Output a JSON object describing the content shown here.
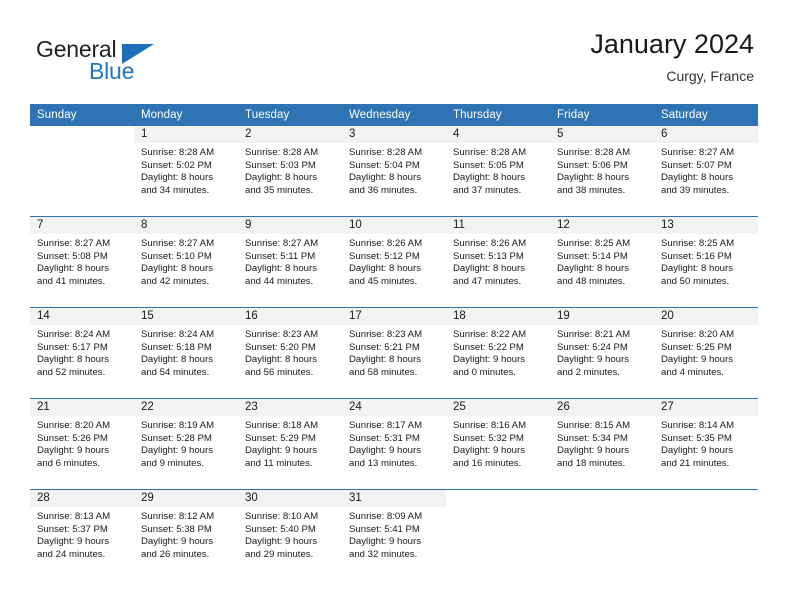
{
  "logo": {
    "word1": "General",
    "word2": "Blue",
    "triangle_color": "#1d70b8",
    "blue_color": "#2176ba"
  },
  "header": {
    "title": "January 2024",
    "location": "Curgy, France",
    "accent_color": "#2e74b5",
    "band_color": "#f2f2f2"
  },
  "weekday_headers": [
    "Sunday",
    "Monday",
    "Tuesday",
    "Wednesday",
    "Thursday",
    "Friday",
    "Saturday"
  ],
  "weeks": [
    [
      {
        "day": "",
        "line1": "",
        "line2": "",
        "line3": "",
        "line4": ""
      },
      {
        "day": "1",
        "line1": "Sunrise: 8:28 AM",
        "line2": "Sunset: 5:02 PM",
        "line3": "Daylight: 8 hours",
        "line4": "and 34 minutes."
      },
      {
        "day": "2",
        "line1": "Sunrise: 8:28 AM",
        "line2": "Sunset: 5:03 PM",
        "line3": "Daylight: 8 hours",
        "line4": "and 35 minutes."
      },
      {
        "day": "3",
        "line1": "Sunrise: 8:28 AM",
        "line2": "Sunset: 5:04 PM",
        "line3": "Daylight: 8 hours",
        "line4": "and 36 minutes."
      },
      {
        "day": "4",
        "line1": "Sunrise: 8:28 AM",
        "line2": "Sunset: 5:05 PM",
        "line3": "Daylight: 8 hours",
        "line4": "and 37 minutes."
      },
      {
        "day": "5",
        "line1": "Sunrise: 8:28 AM",
        "line2": "Sunset: 5:06 PM",
        "line3": "Daylight: 8 hours",
        "line4": "and 38 minutes."
      },
      {
        "day": "6",
        "line1": "Sunrise: 8:27 AM",
        "line2": "Sunset: 5:07 PM",
        "line3": "Daylight: 8 hours",
        "line4": "and 39 minutes."
      }
    ],
    [
      {
        "day": "7",
        "line1": "Sunrise: 8:27 AM",
        "line2": "Sunset: 5:08 PM",
        "line3": "Daylight: 8 hours",
        "line4": "and 41 minutes."
      },
      {
        "day": "8",
        "line1": "Sunrise: 8:27 AM",
        "line2": "Sunset: 5:10 PM",
        "line3": "Daylight: 8 hours",
        "line4": "and 42 minutes."
      },
      {
        "day": "9",
        "line1": "Sunrise: 8:27 AM",
        "line2": "Sunset: 5:11 PM",
        "line3": "Daylight: 8 hours",
        "line4": "and 44 minutes."
      },
      {
        "day": "10",
        "line1": "Sunrise: 8:26 AM",
        "line2": "Sunset: 5:12 PM",
        "line3": "Daylight: 8 hours",
        "line4": "and 45 minutes."
      },
      {
        "day": "11",
        "line1": "Sunrise: 8:26 AM",
        "line2": "Sunset: 5:13 PM",
        "line3": "Daylight: 8 hours",
        "line4": "and 47 minutes."
      },
      {
        "day": "12",
        "line1": "Sunrise: 8:25 AM",
        "line2": "Sunset: 5:14 PM",
        "line3": "Daylight: 8 hours",
        "line4": "and 48 minutes."
      },
      {
        "day": "13",
        "line1": "Sunrise: 8:25 AM",
        "line2": "Sunset: 5:16 PM",
        "line3": "Daylight: 8 hours",
        "line4": "and 50 minutes."
      }
    ],
    [
      {
        "day": "14",
        "line1": "Sunrise: 8:24 AM",
        "line2": "Sunset: 5:17 PM",
        "line3": "Daylight: 8 hours",
        "line4": "and 52 minutes."
      },
      {
        "day": "15",
        "line1": "Sunrise: 8:24 AM",
        "line2": "Sunset: 5:18 PM",
        "line3": "Daylight: 8 hours",
        "line4": "and 54 minutes."
      },
      {
        "day": "16",
        "line1": "Sunrise: 8:23 AM",
        "line2": "Sunset: 5:20 PM",
        "line3": "Daylight: 8 hours",
        "line4": "and 56 minutes."
      },
      {
        "day": "17",
        "line1": "Sunrise: 8:23 AM",
        "line2": "Sunset: 5:21 PM",
        "line3": "Daylight: 8 hours",
        "line4": "and 58 minutes."
      },
      {
        "day": "18",
        "line1": "Sunrise: 8:22 AM",
        "line2": "Sunset: 5:22 PM",
        "line3": "Daylight: 9 hours",
        "line4": "and 0 minutes."
      },
      {
        "day": "19",
        "line1": "Sunrise: 8:21 AM",
        "line2": "Sunset: 5:24 PM",
        "line3": "Daylight: 9 hours",
        "line4": "and 2 minutes."
      },
      {
        "day": "20",
        "line1": "Sunrise: 8:20 AM",
        "line2": "Sunset: 5:25 PM",
        "line3": "Daylight: 9 hours",
        "line4": "and 4 minutes."
      }
    ],
    [
      {
        "day": "21",
        "line1": "Sunrise: 8:20 AM",
        "line2": "Sunset: 5:26 PM",
        "line3": "Daylight: 9 hours",
        "line4": "and 6 minutes."
      },
      {
        "day": "22",
        "line1": "Sunrise: 8:19 AM",
        "line2": "Sunset: 5:28 PM",
        "line3": "Daylight: 9 hours",
        "line4": "and 9 minutes."
      },
      {
        "day": "23",
        "line1": "Sunrise: 8:18 AM",
        "line2": "Sunset: 5:29 PM",
        "line3": "Daylight: 9 hours",
        "line4": "and 11 minutes."
      },
      {
        "day": "24",
        "line1": "Sunrise: 8:17 AM",
        "line2": "Sunset: 5:31 PM",
        "line3": "Daylight: 9 hours",
        "line4": "and 13 minutes."
      },
      {
        "day": "25",
        "line1": "Sunrise: 8:16 AM",
        "line2": "Sunset: 5:32 PM",
        "line3": "Daylight: 9 hours",
        "line4": "and 16 minutes."
      },
      {
        "day": "26",
        "line1": "Sunrise: 8:15 AM",
        "line2": "Sunset: 5:34 PM",
        "line3": "Daylight: 9 hours",
        "line4": "and 18 minutes."
      },
      {
        "day": "27",
        "line1": "Sunrise: 8:14 AM",
        "line2": "Sunset: 5:35 PM",
        "line3": "Daylight: 9 hours",
        "line4": "and 21 minutes."
      }
    ],
    [
      {
        "day": "28",
        "line1": "Sunrise: 8:13 AM",
        "line2": "Sunset: 5:37 PM",
        "line3": "Daylight: 9 hours",
        "line4": "and 24 minutes."
      },
      {
        "day": "29",
        "line1": "Sunrise: 8:12 AM",
        "line2": "Sunset: 5:38 PM",
        "line3": "Daylight: 9 hours",
        "line4": "and 26 minutes."
      },
      {
        "day": "30",
        "line1": "Sunrise: 8:10 AM",
        "line2": "Sunset: 5:40 PM",
        "line3": "Daylight: 9 hours",
        "line4": "and 29 minutes."
      },
      {
        "day": "31",
        "line1": "Sunrise: 8:09 AM",
        "line2": "Sunset: 5:41 PM",
        "line3": "Daylight: 9 hours",
        "line4": "and 32 minutes."
      },
      {
        "day": "",
        "line1": "",
        "line2": "",
        "line3": "",
        "line4": ""
      },
      {
        "day": "",
        "line1": "",
        "line2": "",
        "line3": "",
        "line4": ""
      },
      {
        "day": "",
        "line1": "",
        "line2": "",
        "line3": "",
        "line4": ""
      }
    ]
  ]
}
